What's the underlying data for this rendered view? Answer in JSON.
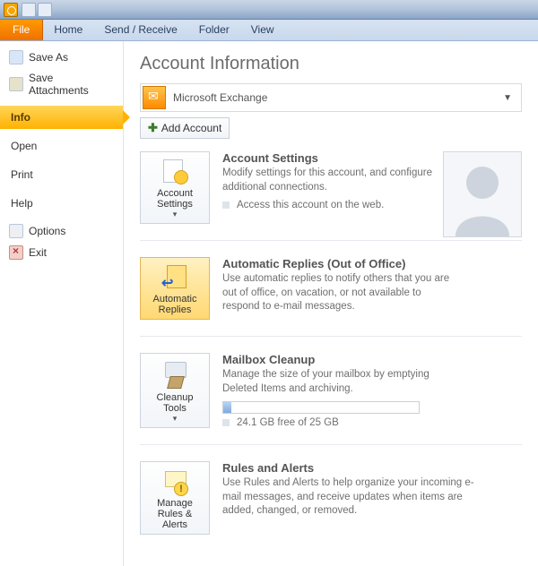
{
  "ribbon": {
    "file": "File",
    "tabs": [
      "Home",
      "Send / Receive",
      "Folder",
      "View"
    ]
  },
  "sidebar": {
    "save_as": "Save As",
    "save_attachments": "Save Attachments",
    "info": "Info",
    "open": "Open",
    "print": "Print",
    "help": "Help",
    "options": "Options",
    "exit": "Exit"
  },
  "content": {
    "title": "Account Information",
    "account_name": "Microsoft Exchange",
    "add_account": "Add Account",
    "sections": {
      "settings": {
        "btn": "Account Settings",
        "heading": "Account Settings",
        "desc": "Modify settings for this account, and configure additional connections.",
        "sub": "Access this account on the web."
      },
      "auto": {
        "btn": "Automatic Replies",
        "heading": "Automatic Replies (Out of Office)",
        "desc": "Use automatic replies to notify others that you are out of office, on vacation, or not available to respond to e-mail messages."
      },
      "cleanup": {
        "btn": "Cleanup Tools",
        "heading": "Mailbox Cleanup",
        "desc": "Manage the size of your mailbox by emptying Deleted Items and archiving.",
        "free_label": "24.1 GB free of 25 GB"
      },
      "rules": {
        "btn": "Manage Rules & Alerts",
        "heading": "Rules and Alerts",
        "desc": "Use Rules and Alerts to help organize your incoming e-mail messages, and receive updates when items are added, changed, or removed."
      }
    }
  }
}
